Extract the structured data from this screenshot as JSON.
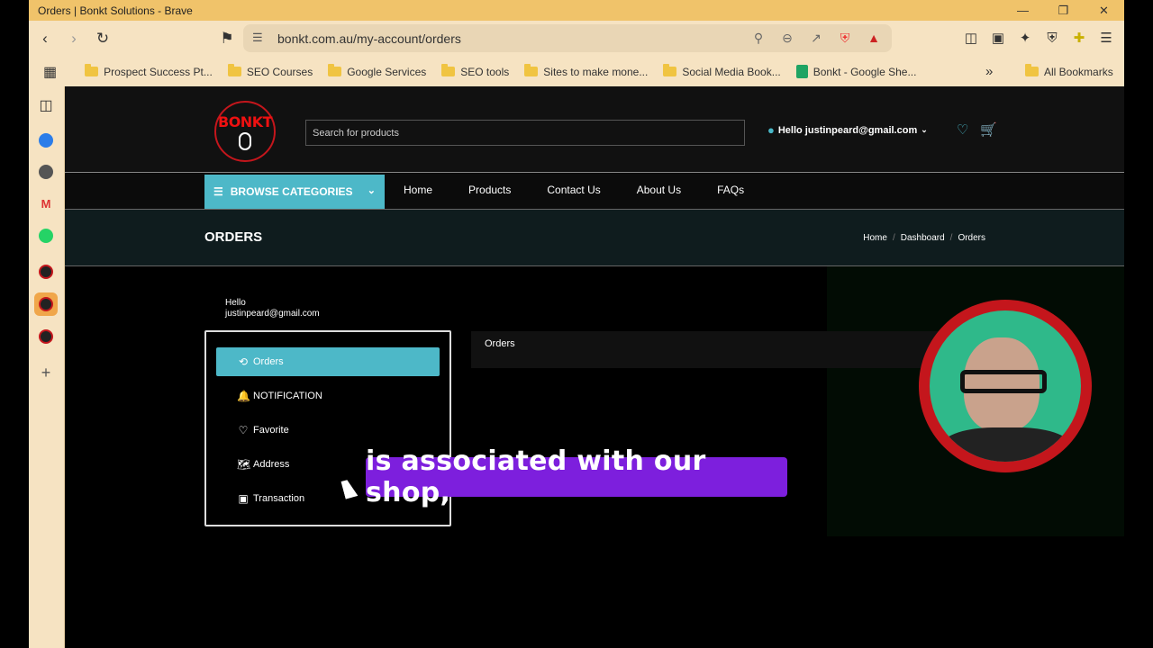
{
  "window": {
    "title": "Orders | Bonkt Solutions - Brave",
    "controls": [
      "minimize-icon",
      "restore-icon",
      "close-icon"
    ]
  },
  "toolbar": {
    "url": "bonkt.com.au/my-account/orders"
  },
  "bookmarks": {
    "items": [
      {
        "label": "Prospect Success Pt...",
        "icon": "folder-icon"
      },
      {
        "label": "SEO Courses",
        "icon": "folder-icon"
      },
      {
        "label": "Google Services",
        "icon": "folder-icon"
      },
      {
        "label": "SEO tools",
        "icon": "folder-icon"
      },
      {
        "label": "Sites to make mone...",
        "icon": "folder-icon"
      },
      {
        "label": "Social Media Book...",
        "icon": "folder-icon"
      },
      {
        "label": "Bonkt - Google She...",
        "icon": "sheets-icon"
      }
    ],
    "all_label": "All Bookmarks",
    "overflow": "»"
  },
  "site": {
    "logo_text": "BONKT",
    "search_placeholder": "Search for products",
    "hello_user": "Hello justinpeard@gmail.com",
    "browse_label": "BROWSE CATEGORIES",
    "nav": [
      "Home",
      "Products",
      "Contact Us",
      "About Us",
      "FAQs"
    ],
    "page_title": "ORDERS",
    "breadcrumb": [
      "Home",
      "Dashboard",
      "Orders"
    ],
    "breadcrumb_sep": "/",
    "hello_label": "Hello",
    "hello_email": "justinpeard@gmail.com",
    "menu": [
      {
        "label": "Orders",
        "icon": "history-icon",
        "active": true
      },
      {
        "label": "NOTIFICATION",
        "icon": "bell-icon",
        "active": false
      },
      {
        "label": "Favorite",
        "icon": "heart-icon",
        "active": false
      },
      {
        "label": "Address",
        "icon": "map-icon",
        "active": false
      },
      {
        "label": "Transaction",
        "icon": "money-icon",
        "active": false
      }
    ],
    "orders_box": "Orders",
    "accent": "#4db8c8"
  },
  "caption": "is associated with our shop,"
}
